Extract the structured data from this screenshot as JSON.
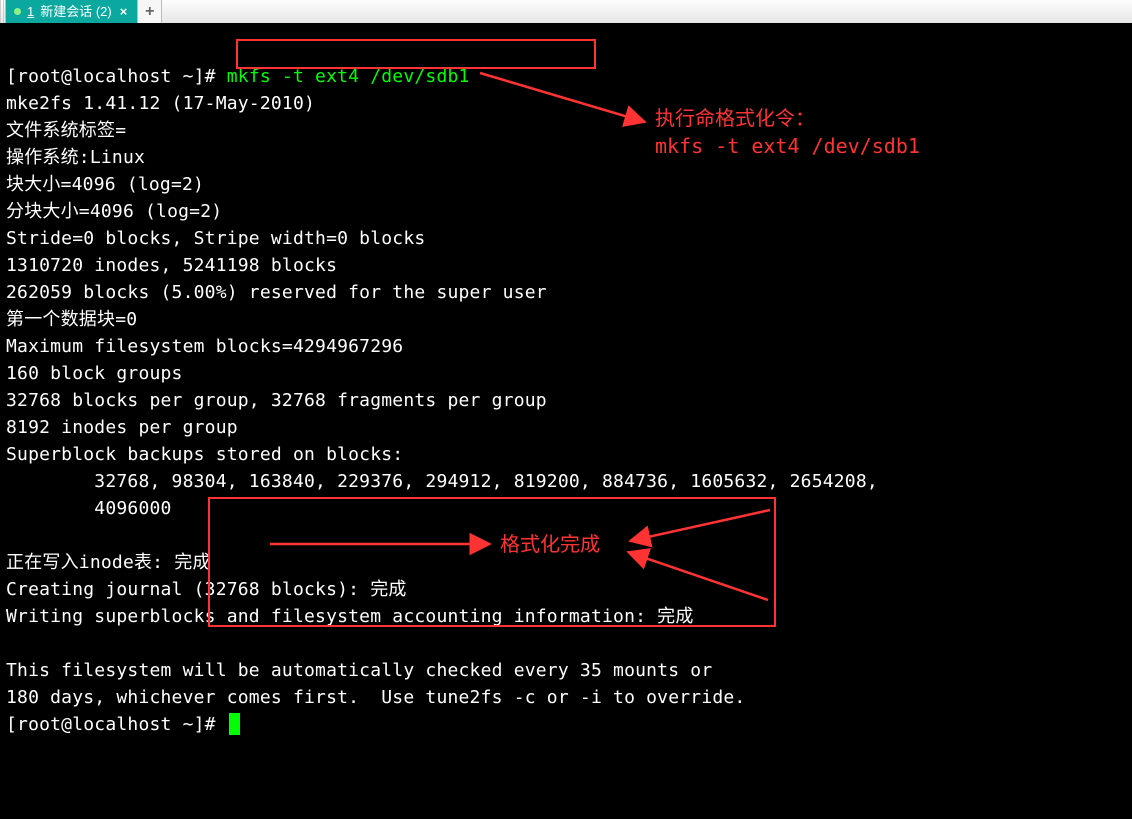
{
  "tabbar": {
    "tab1": {
      "num": "1",
      "label": "新建会话 (2)"
    },
    "newtab": "+"
  },
  "term": {
    "prompt1_user": "[root@localhost ~]# ",
    "prompt1_cmd": "mkfs -t ext4 /dev/sdb1",
    "l2": "mke2fs 1.41.12 (17-May-2010)",
    "l3": "文件系统标签=",
    "l4": "操作系统:Linux",
    "l5": "块大小=4096 (log=2)",
    "l6": "分块大小=4096 (log=2)",
    "l7": "Stride=0 blocks, Stripe width=0 blocks",
    "l8": "1310720 inodes, 5241198 blocks",
    "l9": "262059 blocks (5.00%) reserved for the super user",
    "l10": "第一个数据块=0",
    "l11": "Maximum filesystem blocks=4294967296",
    "l12": "160 block groups",
    "l13": "32768 blocks per group, 32768 fragments per group",
    "l14": "8192 inodes per group",
    "l15": "Superblock backups stored on blocks: ",
    "l16": "        32768, 98304, 163840, 229376, 294912, 819200, 884736, 1605632, 2654208, ",
    "l17": "        4096000",
    "l18": " ",
    "l19": "正在写入inode表: 完成                            ",
    "l20": "Creating journal (32768 blocks): 完成",
    "l21": "Writing superblocks and filesystem accounting information: 完成",
    "l22": " ",
    "l23": "This filesystem will be automatically checked every 35 mounts or",
    "l24": "180 days, whichever comes first.  Use tune2fs -c or -i to override.",
    "prompt2": "[root@localhost ~]# "
  },
  "annot": {
    "a1_line1": "执行命格式化令：",
    "a1_line2": "mkfs -t ext4 /dev/sdb1",
    "a2": "格式化完成"
  }
}
